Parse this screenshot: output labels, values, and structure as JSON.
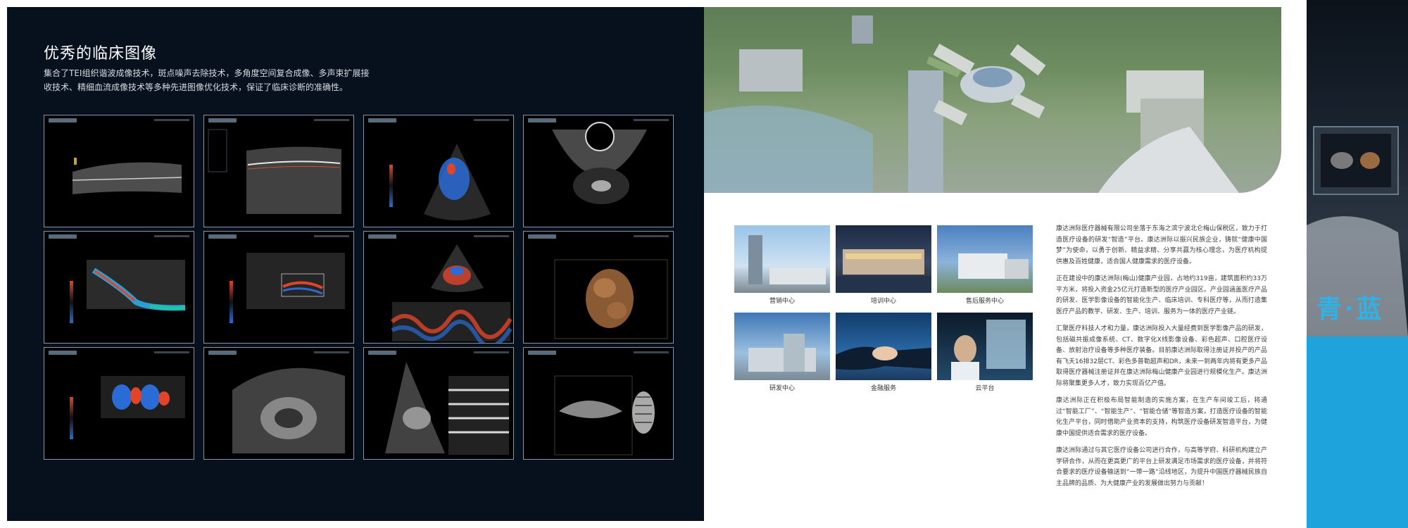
{
  "left_page": {
    "title": "优秀的临床图像",
    "description_line1": "集合了TEI组织谐波成像技术，斑点噪声去除技术，多角度空间复合成像、多声束扩展接",
    "description_line2": "收技术、精细血流成像技术等多种先进图像优化技术，保证了临床诊断的准确性。",
    "scans": [
      {
        "label": "scan-1"
      },
      {
        "label": "scan-2"
      },
      {
        "label": "scan-3"
      },
      {
        "label": "scan-4"
      },
      {
        "label": "scan-5"
      },
      {
        "label": "scan-6"
      },
      {
        "label": "scan-7"
      },
      {
        "label": "scan-8"
      },
      {
        "label": "scan-9"
      },
      {
        "label": "scan-10"
      },
      {
        "label": "scan-11"
      },
      {
        "label": "scan-12"
      }
    ]
  },
  "right_page": {
    "photos": [
      {
        "caption": "营销中心"
      },
      {
        "caption": "培训中心"
      },
      {
        "caption": "售后服务中心"
      },
      {
        "caption": "研发中心"
      },
      {
        "caption": "金融服务"
      },
      {
        "caption": "云平台"
      }
    ],
    "paragraphs": [
      "康达洲际医疗器械有限公司坐落于东海之滨宁波北仑梅山保税区，致力于打造医疗设备的研发“智造”平台。康达洲际以振兴民族企业，铸就“健康中国梦”为使命，以勇于创新、精益求精、分享共赢为核心理念，为医疗机构提供惠及百姓健康，适合国人健康需求的医疗设备。",
      "正在建设中的康达洲际(梅山)健康产业园，占地约319亩，建筑面积约33万平方米，将投入资金25亿元打造新型的医疗产业园区。产业园涵盖医疗产品的研发、医学影像设备的智能化生产、临床培训、专科医疗等，从而打造集医疗产品的教学、研发、生产、培训、服务为一体的医疗产业链。",
      "汇聚医疗科技人才和力量，康达洲际投入大量经费到医学影像产品的研发，包括磁共振成像系统、CT、数字化X线影像设备、彩色超声、口腔医疗设备、放射治疗设备等多种医疗装备。目前康达洲际取得注册证并投产的产品有飞天16排32层CT、彩色多普勒超声和DR，未来一到两年内将有更多产品取得医疗器械注册证并在康达洲际梅山健康产业园进行规模化生产。康达洲际将聚集更多人才，致力实现百亿产值。",
      "康达洲际正在积极布局智能制造的实施方案，在生产车间竣工后，将通过“智能工厂”、“智能生产”、“智能仓储”等智造方案，打造医疗设备的智能化生产平台，同时借助产业资本的支持，构筑医疗设备研发智造平台，为健康中国提供适合需求的医疗设备。",
      "康达洲际通过与其它医疗设备公司进行合作，与高等学府、科研机构建立产学研合作，从而在更高更广的平台上研发满足市场需求的医疗设备，并将符合要求的医疗设备输送到“一带一路”沿线地区，为提升中国医疗器械民族自主品牌的品质、为大健康产业的发展做出努力与贡献！"
    ]
  },
  "brand_strip": {
    "brand_text": "青·蓝"
  },
  "colors": {
    "dark_page": "#07111e",
    "accent_blue": "#1fa3dc",
    "doppler_blue": "#2a6bd6",
    "doppler_red": "#e0452a"
  }
}
